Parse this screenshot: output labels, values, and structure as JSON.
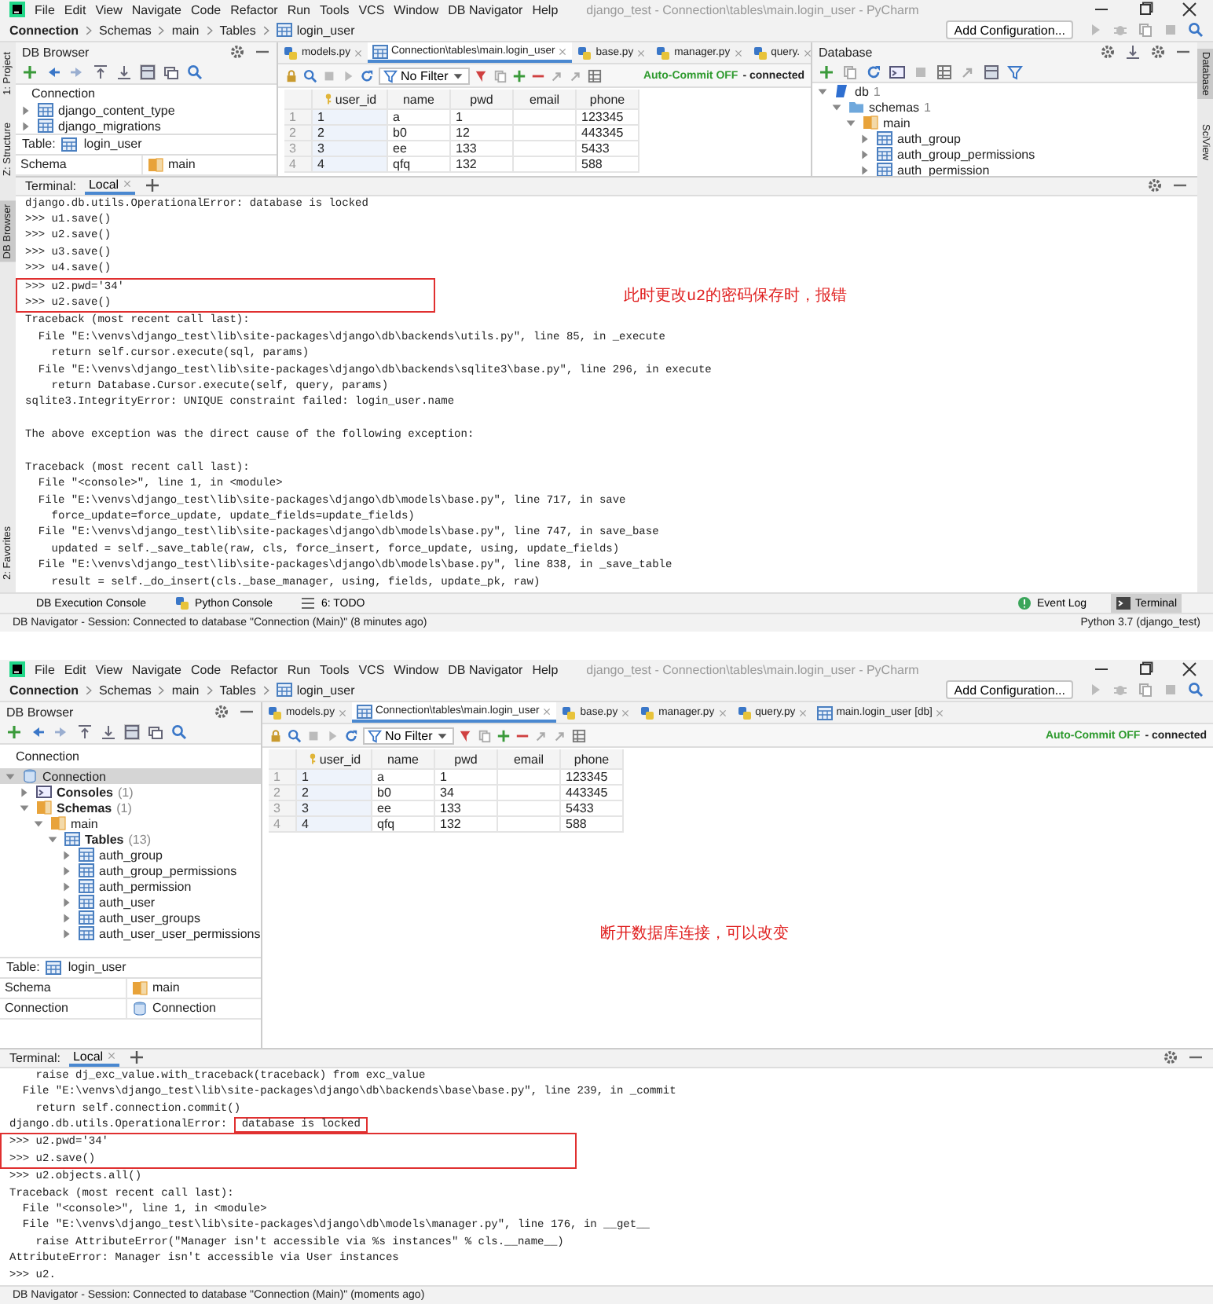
{
  "windows": [
    {
      "title": "django_test - Connection\\tables\\main.login_user - PyCharm",
      "menu": [
        "File",
        "Edit",
        "View",
        "Navigate",
        "Code",
        "Refactor",
        "Run",
        "Tools",
        "VCS",
        "Window",
        "DB Navigator",
        "Help"
      ],
      "breadcrumb": [
        "Connection",
        "Schemas",
        "main",
        "Tables",
        "login_user"
      ],
      "run_config": "Add Configuration...",
      "side_left": [
        {
          "label": "1: Project",
          "selected": false
        },
        {
          "label": "Z: Structure",
          "selected": false
        },
        {
          "label": "DB Browser",
          "selected": true
        },
        {
          "label": "2: Favorites",
          "selected": false
        }
      ],
      "side_right": [
        {
          "label": "Database",
          "selected": true
        },
        {
          "label": "SciView",
          "selected": false
        }
      ],
      "db_browser": {
        "title": "DB Browser",
        "section": "Connection",
        "tree": [
          {
            "label": "django_content_type",
            "kind": "table",
            "expanded": false,
            "selected": false
          },
          {
            "label": "django_migrations",
            "kind": "table",
            "expanded": false,
            "selected": false
          }
        ],
        "table_label": "Table:",
        "table_name": "login_user",
        "properties": [
          {
            "name": "Schema",
            "value": "main",
            "kind": "schema"
          }
        ]
      },
      "editor": {
        "tabs": [
          {
            "label": "models.py",
            "kind": "python",
            "selected": false
          },
          {
            "label": "Connection\\tables\\main.login_user",
            "kind": "table",
            "selected": true
          },
          {
            "label": "base.py",
            "kind": "python",
            "selected": false
          },
          {
            "label": "manager.py",
            "kind": "python",
            "selected": false
          },
          {
            "label": "query.",
            "kind": "python",
            "selected": false
          }
        ],
        "filter": "No Filter",
        "autocommit": "Auto-Commit OFF",
        "state": "- connected",
        "columns": [
          "user_id",
          "name",
          "pwd",
          "email",
          "phone"
        ],
        "rows": [
          {
            "num": "1",
            "cells": [
              "1",
              "a",
              "1",
              null,
              "123345"
            ]
          },
          {
            "num": "2",
            "cells": [
              "2",
              "b0",
              "12",
              null,
              "443345"
            ]
          },
          {
            "num": "3",
            "cells": [
              "3",
              "ee",
              "133",
              null,
              "5433"
            ]
          },
          {
            "num": "4",
            "cells": [
              "4",
              "qfq",
              "132",
              null,
              "588"
            ]
          }
        ]
      },
      "right_panel": {
        "title": "Database",
        "tree": [
          {
            "label": "db",
            "count": "1",
            "kind": "db",
            "expanded": true,
            "selected": false,
            "children": [
              {
                "label": "schemas",
                "count": "1",
                "kind": "folder",
                "expanded": true,
                "selected": false,
                "children": [
                  {
                    "label": "main",
                    "kind": "schema",
                    "expanded": true,
                    "selected": false,
                    "children": [
                      {
                        "label": "auth_group",
                        "kind": "table",
                        "expanded": false,
                        "selected": false
                      },
                      {
                        "label": "auth_group_permissions",
                        "kind": "table",
                        "expanded": false,
                        "selected": false
                      },
                      {
                        "label": "auth_permission",
                        "kind": "table",
                        "expanded": false,
                        "selected": false
                      }
                    ]
                  }
                ]
              }
            ]
          }
        ]
      },
      "terminal": {
        "label": "Terminal:",
        "tabs": [
          {
            "label": "Local",
            "selected": true
          }
        ],
        "blocks": [
          {
            "kind": "plain",
            "lines": [
              "django.db.utils.OperationalError: database is locked",
              ">>> u1.save()",
              ">>> u2.save()",
              ">>> u3.save()",
              ">>> u4.save()"
            ]
          },
          {
            "kind": "boxed",
            "note": "此时更改u2的密码保存时，报错",
            "lines": [
              ">>> u2.pwd='34'",
              ">>> u2.save()"
            ]
          },
          {
            "kind": "plain",
            "lines": [
              "Traceback (most recent call last):",
              "  File \"E:\\venvs\\django_test\\lib\\site-packages\\django\\db\\backends\\utils.py\", line 85, in _execute",
              "    return self.cursor.execute(sql, params)",
              "  File \"E:\\venvs\\django_test\\lib\\site-packages\\django\\db\\backends\\sqlite3\\base.py\", line 296, in execute",
              "    return Database.Cursor.execute(self, query, params)",
              "sqlite3.IntegrityError: UNIQUE constraint failed: login_user.name"
            ]
          },
          {
            "kind": "gap"
          },
          {
            "kind": "plain",
            "lines": [
              "The above exception was the direct cause of the following exception:"
            ]
          },
          {
            "kind": "gap"
          },
          {
            "kind": "plain",
            "lines": [
              "Traceback (most recent call last):",
              "  File \"<console>\", line 1, in <module>",
              "  File \"E:\\venvs\\django_test\\lib\\site-packages\\django\\db\\models\\base.py\", line 717, in save",
              "    force_update=force_update, update_fields=update_fields)",
              "  File \"E:\\venvs\\django_test\\lib\\site-packages\\django\\db\\models\\base.py\", line 747, in save_base",
              "    updated = self._save_table(raw, cls, force_insert, force_update, using, update_fields)",
              "  File \"E:\\venvs\\django_test\\lib\\site-packages\\django\\db\\models\\base.py\", line 838, in _save_table",
              "    result = self._do_insert(cls._base_manager, using, fields, update_pk, raw)"
            ]
          }
        ]
      },
      "tool_tabs": [
        {
          "label": "DB Execution Console",
          "kind": "console",
          "selected": false
        },
        {
          "label": "Python Console",
          "kind": "python",
          "selected": false
        },
        {
          "label": "6: TODO",
          "kind": "todo",
          "selected": false
        }
      ],
      "tool_tabs_right": [
        {
          "label": "Event Log",
          "kind": "log",
          "selected": false
        },
        {
          "label": "Terminal",
          "kind": "terminal",
          "selected": true
        }
      ],
      "status": "DB Navigator - Session: Connected to database \"Connection (Main)\" (8 minutes ago)",
      "status_right": "Python 3.7 (django_test)"
    },
    {
      "title": "django_test - Connection\\tables\\main.login_user - PyCharm",
      "menu": [
        "File",
        "Edit",
        "View",
        "Navigate",
        "Code",
        "Refactor",
        "Run",
        "Tools",
        "VCS",
        "Window",
        "DB Navigator",
        "Help"
      ],
      "breadcrumb": [
        "Connection",
        "Schemas",
        "main",
        "Tables",
        "login_user"
      ],
      "run_config": "Add Configuration...",
      "db_browser": {
        "title": "DB Browser",
        "section": "Connection",
        "tree": [
          {
            "label": "Connection",
            "kind": "connection",
            "expanded": true,
            "selected": true,
            "children": [
              {
                "label": "Consoles",
                "count": "(1)",
                "kind": "console_folder",
                "expanded": false,
                "selected": false
              },
              {
                "label": "Schemas",
                "count": "(1)",
                "kind": "schema_folder",
                "expanded": true,
                "selected": false,
                "children": [
                  {
                    "label": "main",
                    "kind": "schema",
                    "expanded": true,
                    "selected": false,
                    "children": [
                      {
                        "label": "Tables",
                        "count": "(13)",
                        "kind": "table_folder",
                        "expanded": true,
                        "selected": false,
                        "children": [
                          {
                            "label": "auth_group",
                            "kind": "table",
                            "expanded": false,
                            "selected": false
                          },
                          {
                            "label": "auth_group_permissions",
                            "kind": "table",
                            "expanded": false,
                            "selected": false
                          },
                          {
                            "label": "auth_permission",
                            "kind": "table",
                            "expanded": false,
                            "selected": false
                          },
                          {
                            "label": "auth_user",
                            "kind": "table",
                            "expanded": false,
                            "selected": false
                          },
                          {
                            "label": "auth_user_groups",
                            "kind": "table",
                            "expanded": false,
                            "selected": false
                          },
                          {
                            "label": "auth_user_user_permissions",
                            "kind": "table",
                            "expanded": false,
                            "selected": false
                          }
                        ]
                      }
                    ]
                  }
                ]
              }
            ]
          }
        ],
        "table_label": "Table:",
        "table_name": "login_user",
        "properties": [
          {
            "name": "Schema",
            "value": "main",
            "kind": "schema"
          },
          {
            "name": "Connection",
            "value": "Connection",
            "kind": "connection"
          }
        ]
      },
      "editor": {
        "tabs": [
          {
            "label": "models.py",
            "kind": "python",
            "selected": false
          },
          {
            "label": "Connection\\tables\\main.login_user",
            "kind": "table",
            "selected": true
          },
          {
            "label": "base.py",
            "kind": "python",
            "selected": false
          },
          {
            "label": "manager.py",
            "kind": "python",
            "selected": false
          },
          {
            "label": "query.py",
            "kind": "python",
            "selected": false
          },
          {
            "label": "main.login_user [db]",
            "kind": "table",
            "selected": false
          }
        ],
        "filter": "No Filter",
        "autocommit": "Auto-Commit OFF",
        "state": "- connected",
        "columns": [
          "user_id",
          "name",
          "pwd",
          "email",
          "phone"
        ],
        "rows": [
          {
            "num": "1",
            "cells": [
              "1",
              "a",
              "1",
              null,
              "123345"
            ]
          },
          {
            "num": "2",
            "cells": [
              "2",
              "b0",
              "34",
              null,
              "443345"
            ]
          },
          {
            "num": "3",
            "cells": [
              "3",
              "ee",
              "133",
              null,
              "5433"
            ]
          },
          {
            "num": "4",
            "cells": [
              "4",
              "qfq",
              "132",
              null,
              "588"
            ]
          }
        ],
        "note": "断开数据库连接，可以改变"
      },
      "terminal": {
        "label": "Terminal:",
        "tabs": [
          {
            "label": "Local",
            "selected": true
          }
        ],
        "blocks": [
          {
            "kind": "plain",
            "lines": [
              "    raise dj_exc_value.with_traceback(traceback) from exc_value",
              "  File \"E:\\venvs\\django_test\\lib\\site-packages\\django\\db\\backends\\base\\base.py\", line 239, in _commit",
              "    return self.connection.commit()"
            ]
          },
          {
            "kind": "marked",
            "text": "django.db.utils.OperationalError: ",
            "mark": "database is locked"
          },
          {
            "kind": "boxed",
            "lines": [
              ">>> u2.pwd='34'",
              ">>> u2.save()"
            ]
          },
          {
            "kind": "plain",
            "lines": [
              ">>> u2.objects.all()",
              "Traceback (most recent call last):",
              "  File \"<console>\", line 1, in <module>",
              "  File \"E:\\venvs\\django_test\\lib\\site-packages\\django\\db\\models\\manager.py\", line 176, in __get__",
              "    raise AttributeError(\"Manager isn't accessible via %s instances\" % cls.__name__)",
              "AttributeError: Manager isn't accessible via User instances",
              ">>> u2."
            ]
          }
        ]
      },
      "status": "DB Navigator - Session: Connected to database \"Connection (Main)\" (moments ago)"
    }
  ]
}
